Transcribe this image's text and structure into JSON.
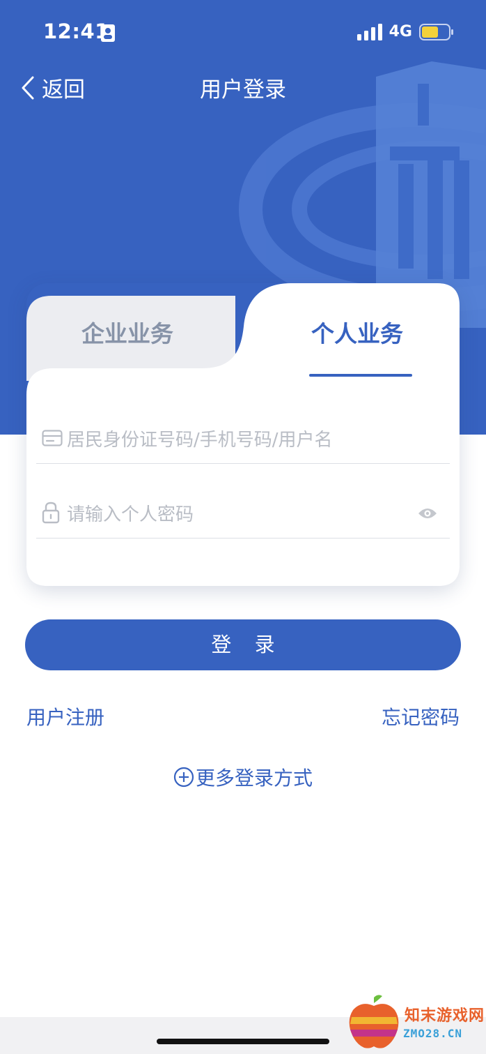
{
  "status_bar": {
    "time": "12:41",
    "network": "4G"
  },
  "nav": {
    "back_label": "返回",
    "title": "用户登录"
  },
  "tabs": [
    {
      "label": "企业业务",
      "active": false
    },
    {
      "label": "个人业务",
      "active": true
    }
  ],
  "form": {
    "id_placeholder": "居民身份证号码/手机号码/用户名",
    "password_placeholder": "请输入个人密码"
  },
  "login_button": "登 录",
  "links": {
    "register": "用户注册",
    "forgot_password": "忘记密码",
    "more_login": "更多登录方式"
  },
  "watermark": {
    "line1": "知末游戏网",
    "line2": "ZMO28.CN"
  },
  "colors": {
    "brand_blue": "#3762c0",
    "tab_inactive_bg": "#ecedf1",
    "inactive_text": "#8793a8",
    "placeholder": "#b9bdc5"
  },
  "icons": {
    "back": "chevron-left-icon",
    "id_field": "id-card-icon",
    "password_field": "lock-icon",
    "password_toggle": "eye-icon",
    "more_login": "plus-circle-icon",
    "battery": "battery-icon",
    "signal": "signal-icon"
  }
}
